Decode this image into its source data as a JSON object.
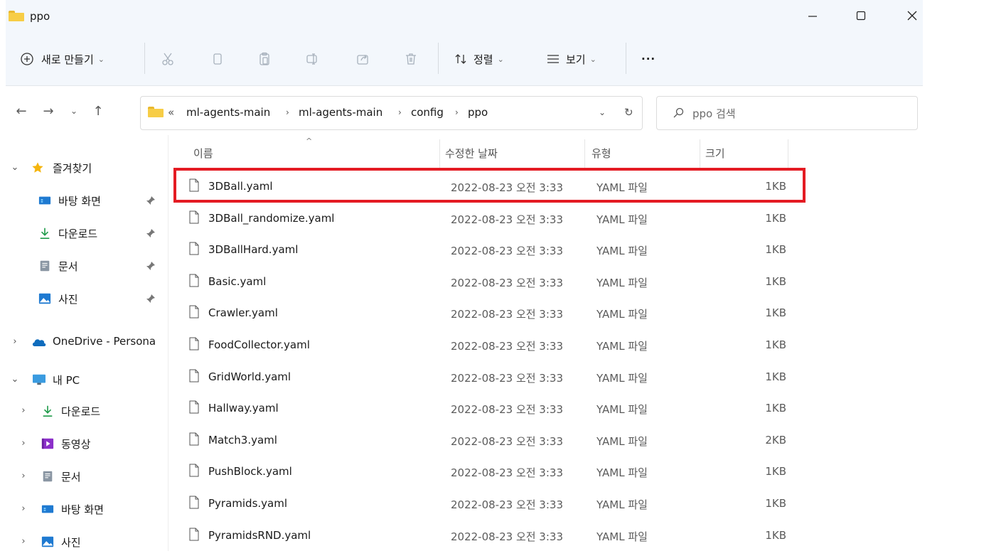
{
  "window": {
    "title": "ppo",
    "controls": [
      "minimize",
      "maximize",
      "close"
    ]
  },
  "toolbar": {
    "new_label": "새로 만들기",
    "sort_label": "정렬",
    "view_label": "보기",
    "more_label": "···"
  },
  "address": {
    "overflow": "«",
    "crumbs": [
      "ml-agents-main",
      "ml-agents-main",
      "config",
      "ppo"
    ],
    "search_placeholder": "ppo 검색"
  },
  "sidebar": {
    "quick_access": "즐겨찾기",
    "pinned": [
      "바탕 화면",
      "다운로드",
      "문서",
      "사진"
    ],
    "onedrive": "OneDrive - Persona",
    "this_pc": "내 PC",
    "pc_items": [
      "다운로드",
      "동영상",
      "문서",
      "바탕 화면",
      "사진"
    ]
  },
  "columns": {
    "name": "이름",
    "date": "수정한 날짜",
    "type": "유형",
    "size": "크기"
  },
  "files": [
    {
      "name": "3DBall.yaml",
      "date": "2022-08-23 오전 3:33",
      "type": "YAML 파일",
      "size": "1KB"
    },
    {
      "name": "3DBall_randomize.yaml",
      "date": "2022-08-23 오전 3:33",
      "type": "YAML 파일",
      "size": "1KB"
    },
    {
      "name": "3DBallHard.yaml",
      "date": "2022-08-23 오전 3:33",
      "type": "YAML 파일",
      "size": "1KB"
    },
    {
      "name": "Basic.yaml",
      "date": "2022-08-23 오전 3:33",
      "type": "YAML 파일",
      "size": "1KB"
    },
    {
      "name": "Crawler.yaml",
      "date": "2022-08-23 오전 3:33",
      "type": "YAML 파일",
      "size": "1KB"
    },
    {
      "name": "FoodCollector.yaml",
      "date": "2022-08-23 오전 3:33",
      "type": "YAML 파일",
      "size": "1KB"
    },
    {
      "name": "GridWorld.yaml",
      "date": "2022-08-23 오전 3:33",
      "type": "YAML 파일",
      "size": "1KB"
    },
    {
      "name": "Hallway.yaml",
      "date": "2022-08-23 오전 3:33",
      "type": "YAML 파일",
      "size": "1KB"
    },
    {
      "name": "Match3.yaml",
      "date": "2022-08-23 오전 3:33",
      "type": "YAML 파일",
      "size": "2KB"
    },
    {
      "name": "PushBlock.yaml",
      "date": "2022-08-23 오전 3:33",
      "type": "YAML 파일",
      "size": "1KB"
    },
    {
      "name": "Pyramids.yaml",
      "date": "2022-08-23 오전 3:33",
      "type": "YAML 파일",
      "size": "1KB"
    },
    {
      "name": "PyramidsRND.yaml",
      "date": "2022-08-23 오전 3:33",
      "type": "YAML 파일",
      "size": "1KB"
    }
  ],
  "highlighted_file": "3DBall.yaml",
  "colors": {
    "highlight": "#e41b23",
    "accent": "#0067c0",
    "folder": "#f7cd46"
  }
}
